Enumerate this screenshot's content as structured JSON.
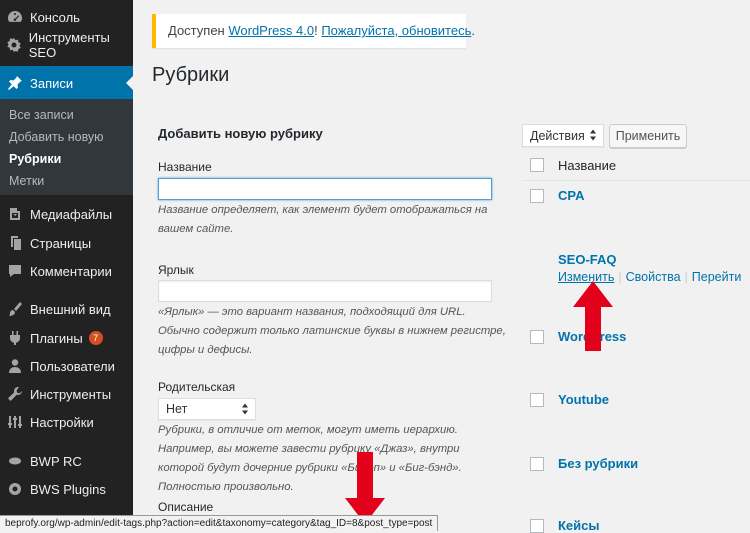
{
  "sidebar": {
    "items": [
      {
        "label": "Консоль",
        "icon": "dashboard-icon"
      },
      {
        "label": "Инструменты SEO",
        "icon": "seo-tools-icon"
      },
      {
        "label": "Записи",
        "icon": "pin-icon",
        "active": true
      },
      {
        "label": "Медиафайлы",
        "icon": "media-icon"
      },
      {
        "label": "Страницы",
        "icon": "pages-icon"
      },
      {
        "label": "Комментарии",
        "icon": "comments-icon"
      },
      {
        "label": "Внешний вид",
        "icon": "appearance-icon"
      },
      {
        "label": "Плагины",
        "icon": "plugins-icon",
        "badge": "7"
      },
      {
        "label": "Пользователи",
        "icon": "users-icon"
      },
      {
        "label": "Инструменты",
        "icon": "tools-icon"
      },
      {
        "label": "Настройки",
        "icon": "settings-icon"
      },
      {
        "label": "BWP RC",
        "icon": "bwp-icon"
      },
      {
        "label": "BWS Plugins",
        "icon": "bws-icon"
      }
    ],
    "submenu": [
      {
        "label": "Все записи"
      },
      {
        "label": "Добавить новую"
      },
      {
        "label": "Рубрики",
        "current": true
      },
      {
        "label": "Метки"
      }
    ]
  },
  "notice": {
    "prefix": "Доступен ",
    "version_link": "WordPress 4.0",
    "middle": "! ",
    "update_link": "Пожалуйста, обновитесь",
    "suffix": "."
  },
  "page_title": "Рубрики",
  "form": {
    "heading": "Добавить новую рубрику",
    "name_label": "Название",
    "name_value": "",
    "name_desc": "Название определяет, как элемент будет отображаться на вашем сайте.",
    "slug_label": "Ярлык",
    "slug_value": "",
    "slug_desc": "«Ярлык» — это вариант названия, подходящий для URL. Обычно содержит только латинские буквы в нижнем регистре, цифры и дефисы.",
    "parent_label": "Родительская",
    "parent_selected": "Нет",
    "parent_desc": "Рубрики, в отличие от меток, могут иметь иерархию. Например, вы можете завести рубрику «Джаз», внутри которой будут дочерние рубрики «Бибоп» и «Биг-бэнд». Полностью произвольно.",
    "description_label": "Описание"
  },
  "table": {
    "bulk_action_selected": "Действия",
    "apply_label": "Применить",
    "column_name": "Название",
    "rows": [
      {
        "name": "CPA"
      },
      {
        "name": "SEO-FAQ"
      },
      {
        "name": "WordPress"
      },
      {
        "name": "Youtube"
      },
      {
        "name": "Без рубрики"
      },
      {
        "name": "Кейсы"
      }
    ],
    "row_actions": {
      "edit": "Изменить",
      "properties": "Свойства",
      "view": "Перейти"
    }
  },
  "status_bar": {
    "url": "beprofy.org/wp-admin/edit-tags.php?action=edit&taxonomy=category&tag_ID=8&post_type=post"
  },
  "colors": {
    "sidebar_bg": "#222222",
    "active_menu": "#0073aa",
    "link": "#0073aa",
    "notice_border": "#ffba00",
    "annotation_arrow": "#e3001b"
  }
}
